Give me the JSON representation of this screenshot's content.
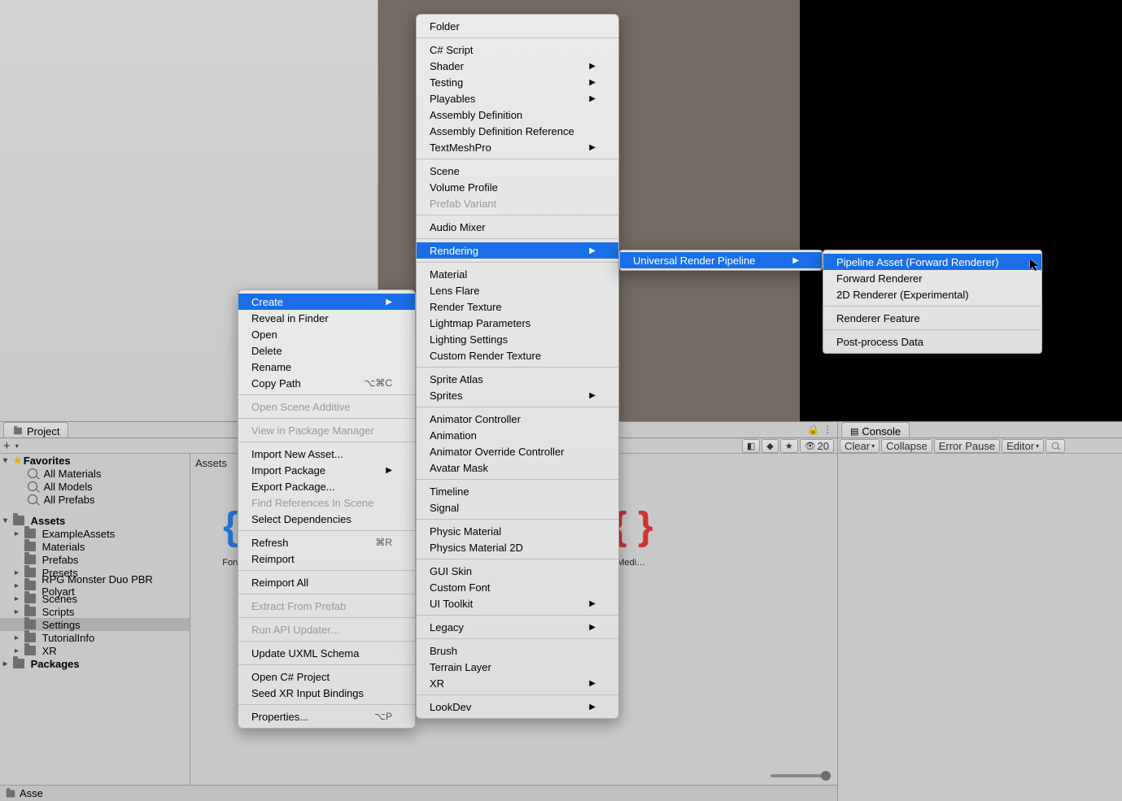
{
  "tabs": {
    "project": "Project",
    "console": "Console"
  },
  "favorites": {
    "header": "Favorites",
    "items": [
      "All Materials",
      "All Models",
      "All Prefabs"
    ]
  },
  "assetsHeader": "Assets",
  "assetsTree": [
    {
      "name": "ExampleAssets",
      "hasChildren": true
    },
    {
      "name": "Materials",
      "hasChildren": false
    },
    {
      "name": "Prefabs",
      "hasChildren": false
    },
    {
      "name": "Presets",
      "hasChildren": true
    },
    {
      "name": "RPG Monster Duo PBR Polyart",
      "hasChildren": true
    },
    {
      "name": "Scenes",
      "hasChildren": true
    },
    {
      "name": "Scripts",
      "hasChildren": true
    },
    {
      "name": "Settings",
      "hasChildren": false,
      "selected": true
    },
    {
      "name": "TutorialInfo",
      "hasChildren": true
    },
    {
      "name": "XR",
      "hasChildren": true
    }
  ],
  "packagesHeader": "Packages",
  "breadcrumb": "Assets",
  "gridLabels": {
    "left": "Forwa…",
    "right": "-Medi…"
  },
  "footerBreadcrumb": "Asse",
  "projToolbar": {
    "hiddenCount": "20"
  },
  "consoleToolbar": [
    "Clear",
    "Collapse",
    "Error Pause",
    "Editor"
  ],
  "menu1": {
    "groups": [
      [
        {
          "t": "Create",
          "sub": true,
          "sel": true
        },
        {
          "t": "Reveal in Finder"
        },
        {
          "t": "Open"
        },
        {
          "t": "Delete"
        },
        {
          "t": "Rename"
        },
        {
          "t": "Copy Path",
          "sc": "⌥⌘C"
        }
      ],
      [
        {
          "t": "Open Scene Additive",
          "dis": true
        }
      ],
      [
        {
          "t": "View in Package Manager",
          "dis": true
        }
      ],
      [
        {
          "t": "Import New Asset..."
        },
        {
          "t": "Import Package",
          "sub": true
        },
        {
          "t": "Export Package..."
        },
        {
          "t": "Find References In Scene",
          "dis": true
        },
        {
          "t": "Select Dependencies"
        }
      ],
      [
        {
          "t": "Refresh",
          "sc": "⌘R"
        },
        {
          "t": "Reimport"
        }
      ],
      [
        {
          "t": "Reimport All"
        }
      ],
      [
        {
          "t": "Extract From Prefab",
          "dis": true
        }
      ],
      [
        {
          "t": "Run API Updater...",
          "dis": true
        }
      ],
      [
        {
          "t": "Update UXML Schema"
        }
      ],
      [
        {
          "t": "Open C# Project"
        },
        {
          "t": "Seed XR Input Bindings"
        }
      ],
      [
        {
          "t": "Properties...",
          "sc": "⌥P"
        }
      ]
    ]
  },
  "menu2": {
    "groups": [
      [
        {
          "t": "Folder"
        }
      ],
      [
        {
          "t": "C# Script"
        },
        {
          "t": "Shader",
          "sub": true
        },
        {
          "t": "Testing",
          "sub": true
        },
        {
          "t": "Playables",
          "sub": true
        },
        {
          "t": "Assembly Definition"
        },
        {
          "t": "Assembly Definition Reference"
        },
        {
          "t": "TextMeshPro",
          "sub": true
        }
      ],
      [
        {
          "t": "Scene"
        },
        {
          "t": "Volume Profile"
        },
        {
          "t": "Prefab Variant",
          "dis": true
        }
      ],
      [
        {
          "t": "Audio Mixer"
        }
      ],
      [
        {
          "t": "Rendering",
          "sub": true,
          "sel": true
        }
      ],
      [
        {
          "t": "Material"
        },
        {
          "t": "Lens Flare"
        },
        {
          "t": "Render Texture"
        },
        {
          "t": "Lightmap Parameters"
        },
        {
          "t": "Lighting Settings"
        },
        {
          "t": "Custom Render Texture"
        }
      ],
      [
        {
          "t": "Sprite Atlas"
        },
        {
          "t": "Sprites",
          "sub": true
        }
      ],
      [
        {
          "t": "Animator Controller"
        },
        {
          "t": "Animation"
        },
        {
          "t": "Animator Override Controller"
        },
        {
          "t": "Avatar Mask"
        }
      ],
      [
        {
          "t": "Timeline"
        },
        {
          "t": "Signal"
        }
      ],
      [
        {
          "t": "Physic Material"
        },
        {
          "t": "Physics Material 2D"
        }
      ],
      [
        {
          "t": "GUI Skin"
        },
        {
          "t": "Custom Font"
        },
        {
          "t": "UI Toolkit",
          "sub": true
        }
      ],
      [
        {
          "t": "Legacy",
          "sub": true
        }
      ],
      [
        {
          "t": "Brush"
        },
        {
          "t": "Terrain Layer"
        },
        {
          "t": "XR",
          "sub": true
        }
      ],
      [
        {
          "t": "LookDev",
          "sub": true
        }
      ]
    ]
  },
  "menu3": {
    "groups": [
      [
        {
          "t": "Universal Render Pipeline",
          "sub": true,
          "sel": true
        }
      ]
    ]
  },
  "menu4": {
    "groups": [
      [
        {
          "t": "Pipeline Asset (Forward Renderer)",
          "sel": true
        },
        {
          "t": "Forward Renderer"
        },
        {
          "t": "2D Renderer (Experimental)"
        }
      ],
      [
        {
          "t": "Renderer Feature"
        }
      ],
      [
        {
          "t": "Post-process Data"
        }
      ]
    ]
  }
}
